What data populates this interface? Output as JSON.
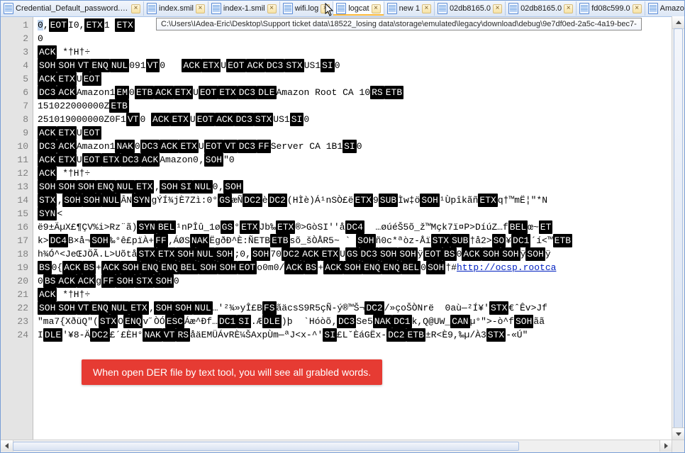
{
  "tabs": [
    {
      "label": "Credential_Default_password.html",
      "active": false
    },
    {
      "label": "index.smil",
      "active": false
    },
    {
      "label": "index-1.smil",
      "active": false
    },
    {
      "label": "wifi.log",
      "active": false
    },
    {
      "label": "logcat",
      "active": true
    },
    {
      "label": "new 1",
      "active": false
    },
    {
      "label": "02db8165.0",
      "active": false
    },
    {
      "label": "02db8165.0",
      "active": false
    },
    {
      "label": "fd08c599.0",
      "active": false
    },
    {
      "label": "Amazo",
      "active": false
    }
  ],
  "tooltip": "C:\\Users\\IAdea-Eric\\Desktop\\Support ticket data\\18522_losing data\\storage\\emulated\\legacy\\download\\debug\\9e7df0ed-2a5c-4a19-bec7-",
  "callout": "When open DER file by text tool, you will see all grabled words.",
  "line_count": 24,
  "lines": [
    [
      {
        "sel": true,
        "t": "0"
      },
      {
        "t": ","
      },
      {
        "cc": true,
        "t": "EOT"
      },
      {
        "t": "I0,"
      },
      {
        "cc": true,
        "t": "ETX"
      },
      {
        "t": "1 "
      },
      {
        "cc": true,
        "t": "ETX"
      }
    ],
    [
      {
        "t": "0"
      }
    ],
    [
      {
        "cc": true,
        "t": "ACK"
      },
      {
        "t": " *†H†÷"
      }
    ],
    [
      {
        "cc": true,
        "t": "SOH"
      },
      {
        "cc": true,
        "t": "SOH"
      },
      {
        "cc": true,
        "t": "VT"
      },
      {
        "cc": true,
        "t": "ENQ"
      },
      {
        "cc": true,
        "t": "NUL"
      },
      {
        "t": "091"
      },
      {
        "cc": true,
        "t": "VT"
      },
      {
        "t": "0   "
      },
      {
        "cc": true,
        "t": "ACK"
      },
      {
        "cc": true,
        "t": "ETX"
      },
      {
        "t": "U"
      },
      {
        "cc": true,
        "t": "EOT"
      },
      {
        "cc": true,
        "t": "ACK"
      },
      {
        "cc": true,
        "t": "DC3"
      },
      {
        "cc": true,
        "t": "STX"
      },
      {
        "t": "US1"
      },
      {
        "cc": true,
        "t": "SI"
      },
      {
        "t": "0"
      }
    ],
    [
      {
        "cc": true,
        "t": "ACK"
      },
      {
        "cc": true,
        "t": "ETX"
      },
      {
        "t": "U"
      },
      {
        "cc": true,
        "t": "EOT"
      }
    ],
    [
      {
        "cc": true,
        "t": "DC3"
      },
      {
        "cc": true,
        "t": "ACK"
      },
      {
        "t": "Amazon1"
      },
      {
        "cc": true,
        "t": "EM"
      },
      {
        "t": "0"
      },
      {
        "cc": true,
        "t": "ETB"
      },
      {
        "cc": true,
        "t": "ACK"
      },
      {
        "cc": true,
        "t": "ETX"
      },
      {
        "t": "U"
      },
      {
        "cc": true,
        "t": "EOT"
      },
      {
        "cc": true,
        "t": "ETX"
      },
      {
        "cc": true,
        "t": "DC3"
      },
      {
        "cc": true,
        "t": "DLE"
      },
      {
        "t": "Amazon Root CA 10"
      },
      {
        "cc": true,
        "t": "RS"
      },
      {
        "cc": true,
        "t": "ETB"
      }
    ],
    [
      {
        "t": "151022000000Z"
      },
      {
        "cc": true,
        "t": "ETB"
      }
    ],
    [
      {
        "t": "251019000000Z0F1"
      },
      {
        "cc": true,
        "t": "VT"
      },
      {
        "t": "0 "
      },
      {
        "cc": true,
        "t": "ACK"
      },
      {
        "cc": true,
        "t": "ETX"
      },
      {
        "t": "U"
      },
      {
        "cc": true,
        "t": "EOT"
      },
      {
        "cc": true,
        "t": "ACK"
      },
      {
        "cc": true,
        "t": "DC3"
      },
      {
        "cc": true,
        "t": "STX"
      },
      {
        "t": "US1"
      },
      {
        "cc": true,
        "t": "SI"
      },
      {
        "t": "0"
      }
    ],
    [
      {
        "cc": true,
        "t": "ACK"
      },
      {
        "cc": true,
        "t": "ETX"
      },
      {
        "t": "U"
      },
      {
        "cc": true,
        "t": "EOT"
      }
    ],
    [
      {
        "cc": true,
        "t": "DC3"
      },
      {
        "cc": true,
        "t": "ACK"
      },
      {
        "t": "Amazon1"
      },
      {
        "cc": true,
        "t": "NAK"
      },
      {
        "t": "0"
      },
      {
        "cc": true,
        "t": "DC3"
      },
      {
        "cc": true,
        "t": "ACK"
      },
      {
        "cc": true,
        "t": "ETX"
      },
      {
        "t": "U"
      },
      {
        "cc": true,
        "t": "EOT"
      },
      {
        "cc": true,
        "t": "VT"
      },
      {
        "cc": true,
        "t": "DC3"
      },
      {
        "cc": true,
        "t": "FF"
      },
      {
        "t": "Server CA 1B1"
      },
      {
        "cc": true,
        "t": "SI"
      },
      {
        "t": "0"
      }
    ],
    [
      {
        "cc": true,
        "t": "ACK"
      },
      {
        "cc": true,
        "t": "ETX"
      },
      {
        "t": "U"
      },
      {
        "cc": true,
        "t": "EOT"
      },
      {
        "cc": true,
        "t": "ETX"
      },
      {
        "cc": true,
        "t": "DC3"
      },
      {
        "cc": true,
        "t": "ACK"
      },
      {
        "t": "Amazon0‚"
      },
      {
        "cc": true,
        "t": "SOH"
      },
      {
        "t": "\"0"
      }
    ],
    [
      {
        "cc": true,
        "t": "ACK"
      },
      {
        "t": " *†H†÷"
      }
    ],
    [
      {
        "cc": true,
        "t": "SOH"
      },
      {
        "cc": true,
        "t": "SOH"
      },
      {
        "cc": true,
        "t": "SOH"
      },
      {
        "cc": true,
        "t": "ENQ"
      },
      {
        "cc": true,
        "t": "NUL"
      },
      {
        "cc": true,
        "t": "ETX"
      },
      {
        "t": "‚"
      },
      {
        "cc": true,
        "t": "SOH"
      },
      {
        "cc": true,
        "t": "SI"
      },
      {
        "cc": true,
        "t": "NUL"
      },
      {
        "t": "0‚"
      },
      {
        "cc": true,
        "t": "SOH"
      }
    ],
    [
      {
        "cc": true,
        "t": "STX"
      },
      {
        "t": "‚"
      },
      {
        "cc": true,
        "t": "SOH"
      },
      {
        "cc": true,
        "t": "SOH"
      },
      {
        "cc": true,
        "t": "NUL"
      },
      {
        "t": "ÂN"
      },
      {
        "cc": true,
        "t": "SYN"
      },
      {
        "t": "gÝÍ¾jÈ7Zì:0°"
      },
      {
        "cc": true,
        "t": "GS"
      },
      {
        "t": "æÑ"
      },
      {
        "cc": true,
        "t": "DC2"
      },
      {
        "t": "è"
      },
      {
        "cc": true,
        "t": "DC2"
      },
      {
        "t": "(HÌè)Á¹nSÒ£ë"
      },
      {
        "cc": true,
        "t": "ETX"
      },
      {
        "t": "9"
      },
      {
        "cc": true,
        "t": "SUB"
      },
      {
        "t": "Ìw‡ö"
      },
      {
        "cc": true,
        "t": "SOH"
      },
      {
        "t": "¹Ùpîkãñ"
      },
      {
        "cc": true,
        "t": "ETX"
      },
      {
        "t": "q†™mË¦\"*N"
      }
    ],
    [
      {
        "cc": true,
        "t": "SYN"
      },
      {
        "t": "<"
      }
    ],
    [
      {
        "t": "ë9±ÄµX£¶ÇV%i>Rz¨ã)"
      },
      {
        "cc": true,
        "t": "SYN"
      },
      {
        "cc": true,
        "t": "BEL"
      },
      {
        "t": "¹nPÎû_1ø"
      },
      {
        "cc": true,
        "t": "GS"
      },
      {
        "t": "°"
      },
      {
        "cc": true,
        "t": "ETX"
      },
      {
        "t": "Jb‰"
      },
      {
        "cc": true,
        "t": "ETX"
      },
      {
        "t": "®>GòSI''å"
      },
      {
        "cc": true,
        "t": "DC4"
      },
      {
        "t": "  …øúéŠ5õ_ž™Mçk7ï¤P>DíúZ…f"
      },
      {
        "cc": true,
        "t": "BEL"
      },
      {
        "t": "œ~"
      },
      {
        "cc": true,
        "t": "ET"
      }
    ],
    [
      {
        "t": "k>"
      },
      {
        "cc": true,
        "t": "DC4"
      },
      {
        "t": "B×å¬"
      },
      {
        "cc": true,
        "t": "SOH"
      },
      {
        "t": "‰°ê£pïÀ+"
      },
      {
        "cc": true,
        "t": "FF"
      },
      {
        "t": "‚ÁØS"
      },
      {
        "cc": true,
        "t": "NAK"
      },
      {
        "t": "ËgðÐ^È:ÑETB"
      },
      {
        "cc": true,
        "t": "ETB"
      },
      {
        "t": "sõ_šÒÅR5~ ` "
      },
      {
        "cc": true,
        "t": "SOH"
      },
      {
        "t": "ñ0c*ªòz-Åï"
      },
      {
        "cc": true,
        "t": "STX"
      },
      {
        "cc": true,
        "t": "SUB"
      },
      {
        "t": "†å2>"
      },
      {
        "cc": true,
        "t": "SO"
      },
      {
        "t": "¥"
      },
      {
        "cc": true,
        "t": "DC1"
      },
      {
        "t": "´í<™"
      },
      {
        "cc": true,
        "t": "ETB"
      }
    ],
    [
      {
        "t": "h¾Ó^<JeŒJÖÃ.L>Uõtå"
      },
      {
        "cc": true,
        "t": "STX"
      },
      {
        "cc": true,
        "t": "ETX"
      },
      {
        "cc": true,
        "t": "SOH"
      },
      {
        "cc": true,
        "t": "NUL"
      },
      {
        "cc": true,
        "t": "SOH"
      },
      {
        "t": ";0,"
      },
      {
        "cc": true,
        "t": "SOH"
      },
      {
        "t": "70"
      },
      {
        "cc": true,
        "t": "DC2"
      },
      {
        "cc": true,
        "t": "ACK"
      },
      {
        "cc": true,
        "t": "ETX"
      },
      {
        "t": "U"
      },
      {
        "cc": true,
        "t": "GS"
      },
      {
        "cc": true,
        "t": "DC3"
      },
      {
        "cc": true,
        "t": "SOH"
      },
      {
        "cc": true,
        "t": "SOH"
      },
      {
        "t": "ÿ"
      },
      {
        "cc": true,
        "t": "EOT"
      },
      {
        "cc": true,
        "t": "BS"
      },
      {
        "t": "0"
      },
      {
        "cc": true,
        "t": "ACK"
      },
      {
        "cc": true,
        "t": "SOH"
      },
      {
        "cc": true,
        "t": "SOH"
      },
      {
        "t": "ÿ"
      },
      {
        "cc": true,
        "t": "SOH"
      },
      {
        "t": "ÿ"
      }
    ],
    [
      {
        "cc": true,
        "t": "BS"
      },
      {
        "t": "0{"
      },
      {
        "cc": true,
        "t": "ACK"
      },
      {
        "cc": true,
        "t": "BS"
      },
      {
        "t": "+"
      },
      {
        "cc": true,
        "t": "ACK"
      },
      {
        "cc": true,
        "t": "SOH"
      },
      {
        "cc": true,
        "t": "ENQ"
      },
      {
        "cc": true,
        "t": "ENQ"
      },
      {
        "cc": true,
        "t": "BEL"
      },
      {
        "cc": true,
        "t": "SOH"
      },
      {
        "cc": true,
        "t": "SOH"
      },
      {
        "cc": true,
        "t": "EOT"
      },
      {
        "t": "o0m0/"
      },
      {
        "cc": true,
        "t": "ACK"
      },
      {
        "cc": true,
        "t": "BS"
      },
      {
        "t": "+"
      },
      {
        "cc": true,
        "t": "ACK"
      },
      {
        "cc": true,
        "t": "SOH"
      },
      {
        "cc": true,
        "t": "ENQ"
      },
      {
        "cc": true,
        "t": "ENQ"
      },
      {
        "cc": true,
        "t": "BEL"
      },
      {
        "t": "0"
      },
      {
        "cc": true,
        "t": "SOH"
      },
      {
        "t": "†#"
      },
      {
        "link": true,
        "t": "http://ocsp.rootca"
      }
    ],
    [
      {
        "t": "0"
      },
      {
        "cc": true,
        "t": "BS"
      },
      {
        "cc": true,
        "t": "ACK"
      },
      {
        "cc": true,
        "t": "ACK"
      },
      {
        "t": "g"
      },
      {
        "cc": true,
        "t": "FF"
      },
      {
        "cc": true,
        "t": "SOH"
      },
      {
        "cc": true,
        "t": "STX"
      },
      {
        "cc": true,
        "t": "SOH"
      },
      {
        "t": "0"
      }
    ],
    [
      {
        "cc": true,
        "t": "ACK"
      },
      {
        "t": " *†H†÷"
      }
    ],
    [
      {
        "cc": true,
        "t": "SOH"
      },
      {
        "cc": true,
        "t": "SOH"
      },
      {
        "cc": true,
        "t": "VT"
      },
      {
        "cc": true,
        "t": "ENQ"
      },
      {
        "cc": true,
        "t": "NUL"
      },
      {
        "cc": true,
        "t": "ETX"
      },
      {
        "t": "‚"
      },
      {
        "cc": true,
        "t": "SOH"
      },
      {
        "cc": true,
        "t": "SOH"
      },
      {
        "cc": true,
        "t": "NUL"
      },
      {
        "t": "…'²¾»yÎ£B"
      },
      {
        "cc": true,
        "t": "FS"
      },
      {
        "t": "ãäcsS9R5çÑ-ý®™Š¬"
      },
      {
        "cc": true,
        "t": "DC2"
      },
      {
        "t": "/»çoŠÒNrë  0aù—²Í¥'"
      },
      {
        "cc": true,
        "t": "STX"
      },
      {
        "t": "€ˆÊv>Jf"
      }
    ],
    [
      {
        "t": "\"ma7{XðüQ\"("
      },
      {
        "cc": true,
        "t": "STX"
      },
      {
        "t": "O"
      },
      {
        "cc": true,
        "t": "ENQ"
      },
      {
        "t": "v˝ÒÓ"
      },
      {
        "cc": true,
        "t": "ESC"
      },
      {
        "t": "Áæ^Ðf…"
      },
      {
        "cc": true,
        "t": "DC1"
      },
      {
        "cc": true,
        "t": "SI"
      },
      {
        "t": ".Æ"
      },
      {
        "cc": true,
        "t": "DLE"
      },
      {
        "t": ")þ  `Hóòõ‚"
      },
      {
        "cc": true,
        "t": "DC3"
      },
      {
        "t": "Se5"
      },
      {
        "cc": true,
        "t": "NAK"
      },
      {
        "cc": true,
        "t": "DC1"
      },
      {
        "t": "k,Q@UW_"
      },
      {
        "cc": true,
        "t": "CAN"
      },
      {
        "t": "µ°\">-ò^f"
      },
      {
        "cc": true,
        "t": "SOH"
      },
      {
        "t": "ãã"
      }
    ],
    [
      {
        "t": "I"
      },
      {
        "cc": true,
        "t": "DLE"
      },
      {
        "t": "'¥8-Ä"
      },
      {
        "cc": true,
        "t": "DC2"
      },
      {
        "t": "£´£ÈH°"
      },
      {
        "cc": true,
        "t": "NAK"
      },
      {
        "cc": true,
        "t": "VT"
      },
      {
        "cc": true,
        "t": "RS"
      },
      {
        "t": "åäEMÜÁvRÈ¼ŠAxpÙm—ªJ<x-^'"
      },
      {
        "cc": true,
        "t": "SI"
      },
      {
        "t": "£LˇÈáGËx-"
      },
      {
        "cc": true,
        "t": "DC2"
      },
      {
        "cc": true,
        "t": "ETB"
      },
      {
        "t": "±R<È9,‰µ/À3"
      },
      {
        "cc": true,
        "t": "STX"
      },
      {
        "t": "-«Ú\""
      }
    ]
  ]
}
